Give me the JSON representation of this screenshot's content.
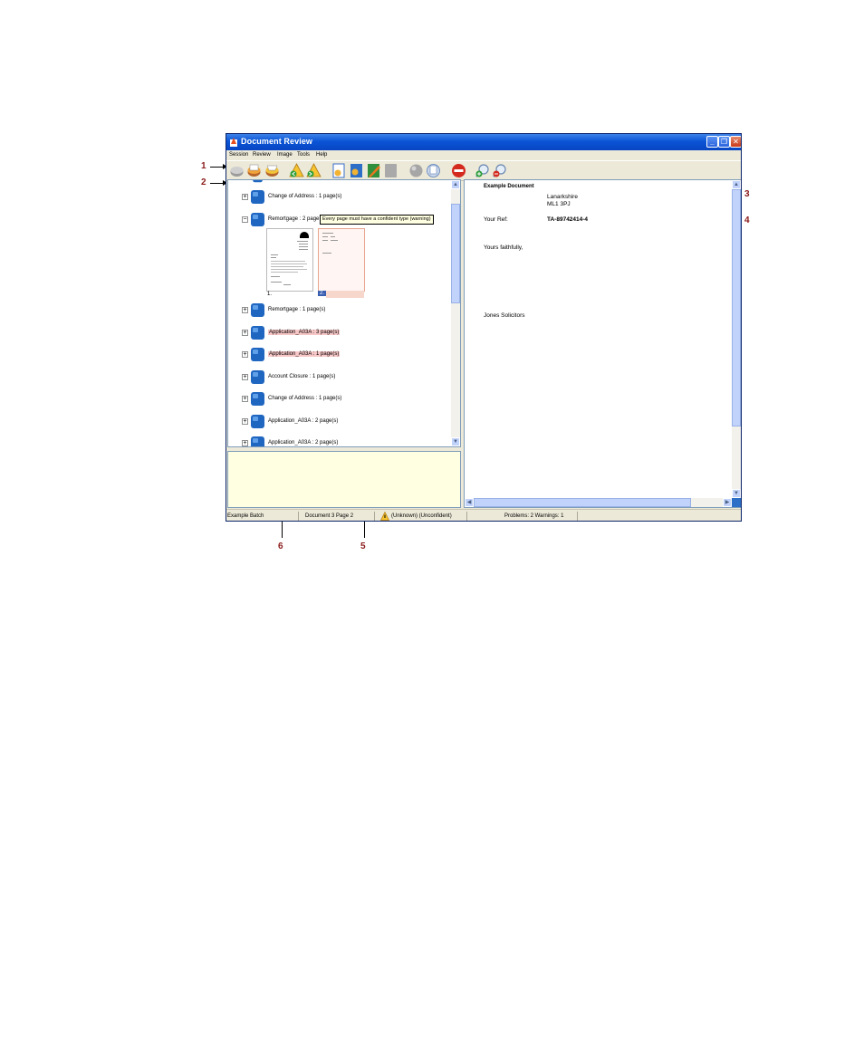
{
  "window": {
    "title": "Document Review",
    "menu": [
      "Session",
      "Review",
      "Image",
      "Tools",
      "Help"
    ],
    "toolbar_icons": [
      "open-batch-icon",
      "save-batch-icon",
      "close-batch-icon",
      "previous-problem-icon",
      "next-problem-icon",
      "document-properties-icon",
      "reclassify-icon",
      "edit-document-icon",
      "merge-icon",
      "split-icon",
      "copy-icon",
      "reject-icon",
      "zoom-in-icon",
      "zoom-out-icon"
    ]
  },
  "tree": {
    "items": [
      {
        "label": "Change of Address : 1 page(s)",
        "problem": false,
        "expander": "+"
      },
      {
        "label": "Remortgage : 2 page",
        "problem": false,
        "expander": "−"
      },
      {
        "label": "Remortgage : 1 page(s)",
        "problem": false,
        "expander": "+"
      },
      {
        "label": "Application_A03A : 3 page(s)",
        "problem": true,
        "expander": "+"
      },
      {
        "label": "Application_A03A : 1 page(s)",
        "problem": true,
        "expander": "+"
      },
      {
        "label": "Account Closure : 1 page(s)",
        "problem": false,
        "expander": "+"
      },
      {
        "label": "Change of Address : 1 page(s)",
        "problem": false,
        "expander": "+"
      },
      {
        "label": "Application_A03A : 2 page(s)",
        "problem": false,
        "expander": "+"
      },
      {
        "label": "Application_A03A : 2 page(s)",
        "problem": false,
        "expander": "+"
      }
    ],
    "thumbnails": [
      {
        "caption": "1."
      },
      {
        "caption": "2."
      }
    ],
    "tooltip": "Every page must have a confident type (warning)"
  },
  "viewer": {
    "heading": "Example Document",
    "address_line1": "Lanarkshire",
    "address_line2": "ML1 3PJ",
    "your_ref_label": "Your Ref:",
    "your_ref_value": "TA-89742414-4",
    "closing": "Yours faithfully,",
    "signature": "Jones Solicitors"
  },
  "statusbar": {
    "batch": "Example Batch",
    "position": "Document 3 Page 2",
    "page_type": "(Unknown) (Unconfident)",
    "summary": "Problems: 2  Warnings: 1"
  },
  "callouts": [
    "1",
    "2",
    "3",
    "4",
    "5",
    "6"
  ],
  "colors": {
    "titlebar": "#0a55d6",
    "problem_highlight": "#f7c6c6",
    "notes_background": "#ffffe1",
    "callout_number": "#8b1a1a"
  }
}
